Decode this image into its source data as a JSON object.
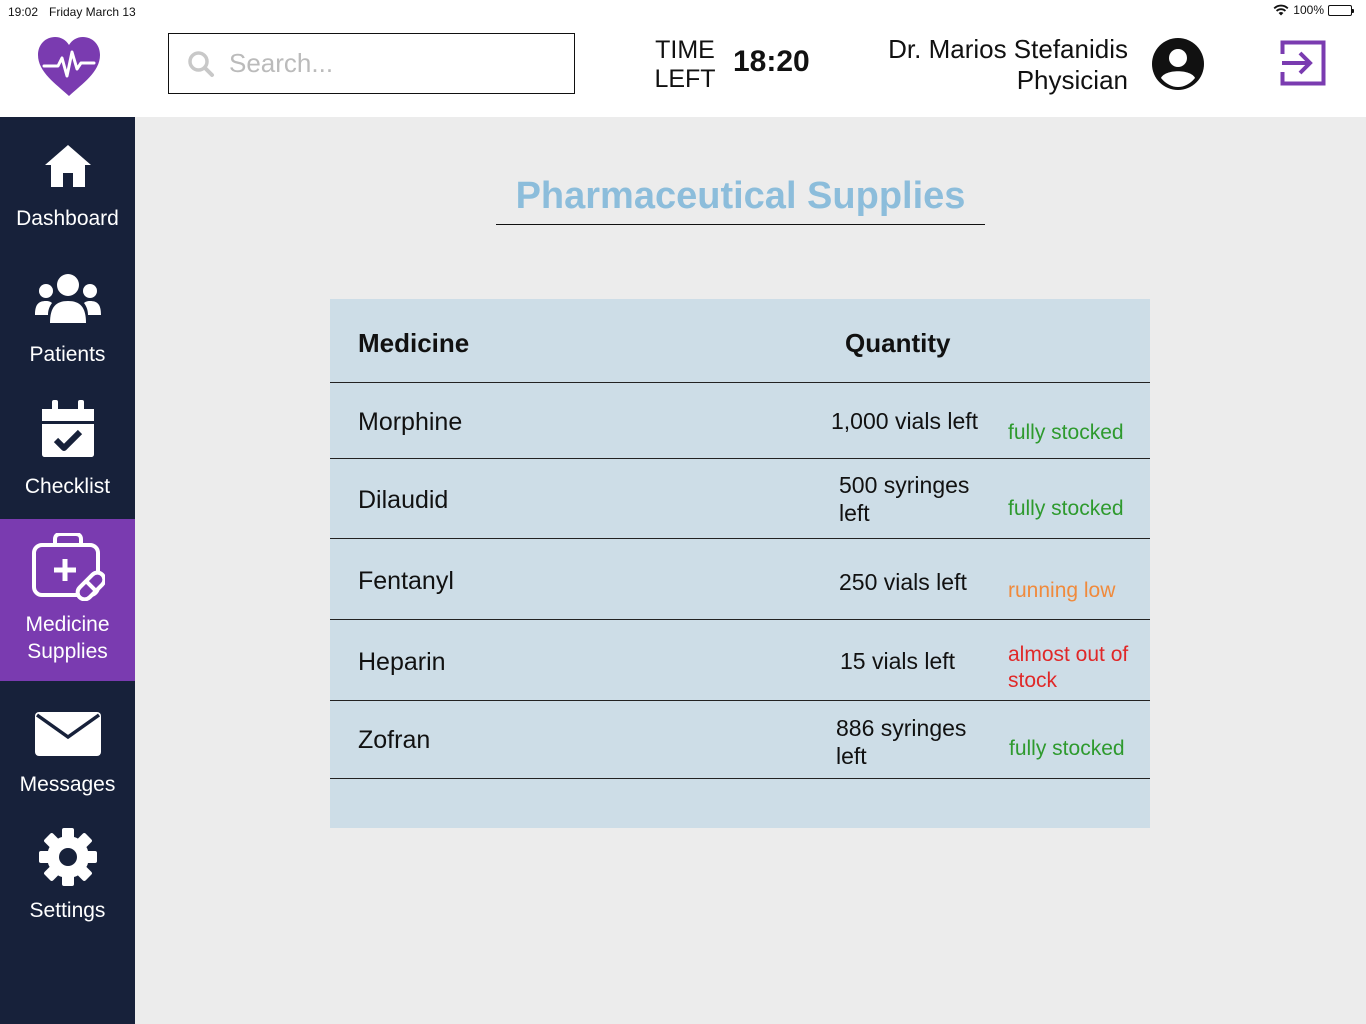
{
  "statusbar": {
    "time": "19:02",
    "date": "Friday March 13",
    "battery": "100%"
  },
  "search": {
    "placeholder": "Search..."
  },
  "timer": {
    "label_line1": "TIME",
    "label_line2": "LEFT",
    "value": "18:20"
  },
  "user": {
    "name": "Dr. Marios Stefanidis",
    "role": "Physician"
  },
  "nav": [
    {
      "label": "Dashboard",
      "icon": "home-icon"
    },
    {
      "label": "Patients",
      "icon": "users-icon"
    },
    {
      "label": "Checklist",
      "icon": "calendar-check-icon"
    },
    {
      "label_line1": "Medicine",
      "label_line2": "Supplies",
      "icon": "medkit-icon",
      "active": true
    },
    {
      "label": "Messages",
      "icon": "envelope-icon"
    },
    {
      "label": "Settings",
      "icon": "gear-icon"
    }
  ],
  "page": {
    "title": "Pharmaceutical Supplies"
  },
  "table": {
    "headers": {
      "medicine": "Medicine",
      "quantity": "Quantity"
    },
    "rows": [
      {
        "medicine": "Morphine",
        "quantity_line1": "1,000 vials left",
        "quantity_line2": "",
        "status_line1": "fully stocked",
        "status_line2": "",
        "status_color": "#2e9a2e"
      },
      {
        "medicine": "Dilaudid",
        "quantity_line1": "500 syringes",
        "quantity_line2": "left",
        "status_line1": "fully stocked",
        "status_line2": "",
        "status_color": "#2e9a2e"
      },
      {
        "medicine": "Fentanyl",
        "quantity_line1": "250 vials left",
        "quantity_line2": "",
        "status_line1": "running low",
        "status_line2": "",
        "status_color": "#f08a3c"
      },
      {
        "medicine": "Heparin",
        "quantity_line1": "15 vials left",
        "quantity_line2": "",
        "status_line1": "almost out of",
        "status_line2": "stock",
        "status_color": "#e02828"
      },
      {
        "medicine": "Zofran",
        "quantity_line1": "886 syringes",
        "quantity_line2": "left",
        "status_line1": "fully stocked",
        "status_line2": "",
        "status_color": "#2e9a2e"
      }
    ]
  },
  "colors": {
    "sidebar": "#17213a",
    "active_nav": "#7a3bb0",
    "brand": "#7a3bb0",
    "title": "#8cbddb",
    "table_bg": "#cddde7"
  }
}
